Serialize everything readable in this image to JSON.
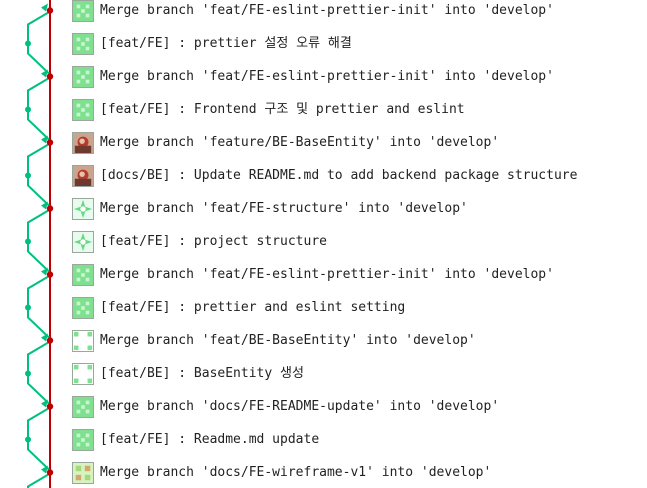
{
  "colors": {
    "mainline": "#c00000",
    "branch": "#00c080",
    "avatar_green": "#7fe08f",
    "avatar_green_alt": "#66d880",
    "avatar_border": "#9aa79d"
  },
  "commits": [
    {
      "message": "Merge branch 'feat/FE-eslint-prettier-init' into 'develop'",
      "avatar": "green-grid-avatar"
    },
    {
      "message": "[feat/FE] : prettier 설정 오류 해결",
      "avatar": "green-grid-avatar"
    },
    {
      "message": "Merge branch 'feat/FE-eslint-prettier-init' into 'develop'",
      "avatar": "green-grid-avatar"
    },
    {
      "message": "[feat/FE] : Frontend 구조 및 prettier and eslint",
      "avatar": "green-grid-avatar"
    },
    {
      "message": "Merge branch 'feature/BE-BaseEntity' into 'develop'",
      "avatar": "photo-avatar"
    },
    {
      "message": "[docs/BE] : Update README.md to add backend package structure",
      "avatar": "photo-avatar"
    },
    {
      "message": "Merge branch 'feat/FE-structure' into 'develop'",
      "avatar": "green-star-avatar"
    },
    {
      "message": "[feat/FE] : project structure",
      "avatar": "green-star-avatar"
    },
    {
      "message": "Merge branch 'feat/FE-eslint-prettier-init' into 'develop'",
      "avatar": "green-grid-avatar"
    },
    {
      "message": "[feat/FE] : prettier and eslint setting",
      "avatar": "green-grid-avatar"
    },
    {
      "message": "Merge branch 'feat/BE-BaseEntity' into 'develop'",
      "avatar": "green-corner-avatar"
    },
    {
      "message": "[feat/BE] : BaseEntity 생성",
      "avatar": "green-corner-avatar"
    },
    {
      "message": "Merge branch 'docs/FE-README-update' into 'develop'",
      "avatar": "green-grid-avatar"
    },
    {
      "message": "[feat/FE] : Readme.md update",
      "avatar": "green-grid-avatar"
    },
    {
      "message": "Merge branch 'docs/FE-wireframe-v1' into 'develop'",
      "avatar": "green-pattern-avatar"
    }
  ]
}
